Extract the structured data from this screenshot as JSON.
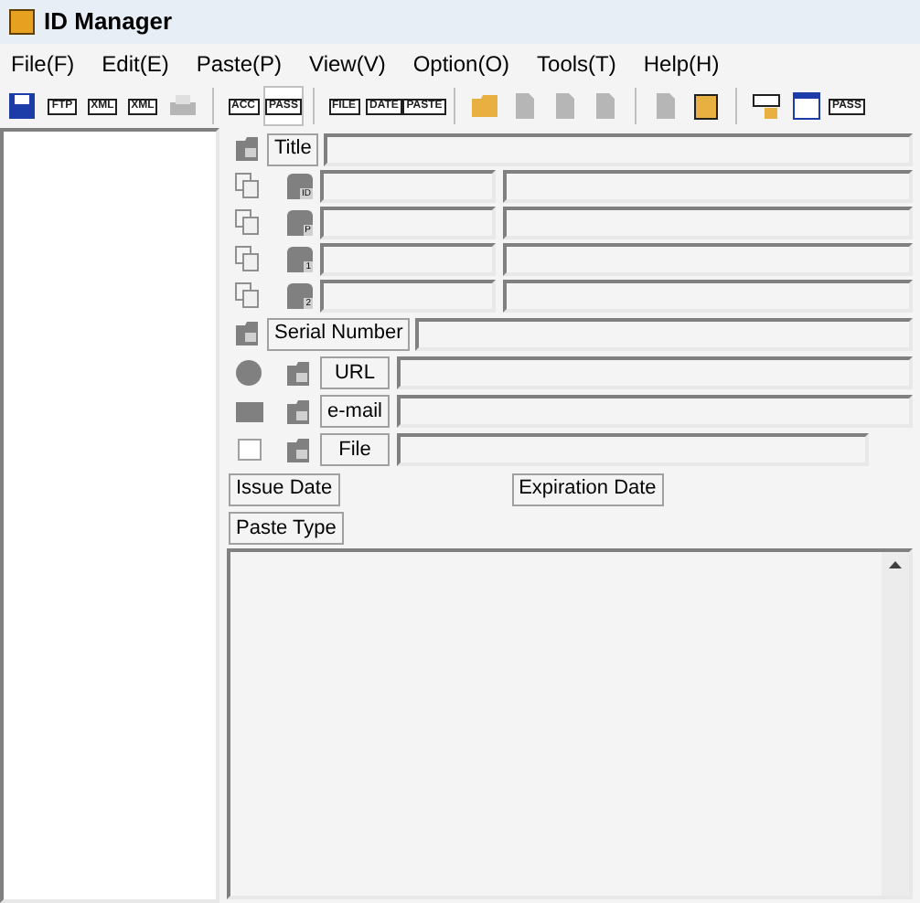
{
  "window": {
    "title": "ID Manager"
  },
  "menu": [
    "File(F)",
    "Edit(E)",
    "Paste(P)",
    "View(V)",
    "Option(O)",
    "Tools(T)",
    "Help(H)"
  ],
  "toolbar": [
    {
      "kind": "save",
      "disabled": false
    },
    {
      "kind": "glyph",
      "glyph": "FTP",
      "disabled": false
    },
    {
      "kind": "glyph",
      "glyph": "XML",
      "disabled": false
    },
    {
      "kind": "glyph",
      "glyph": "XML",
      "disabled": false
    },
    {
      "kind": "print",
      "disabled": true
    },
    {
      "kind": "separator"
    },
    {
      "kind": "glyph",
      "glyph": "ACC",
      "disabled": false,
      "selected": false
    },
    {
      "kind": "glyph",
      "glyph": "PASS",
      "disabled": false,
      "selected": true
    },
    {
      "kind": "separator"
    },
    {
      "kind": "glyph",
      "glyph": "FILE",
      "disabled": false
    },
    {
      "kind": "glyph",
      "glyph": "DATE",
      "disabled": false
    },
    {
      "kind": "glyph",
      "glyph": "PASTE",
      "disabled": false
    },
    {
      "kind": "separator"
    },
    {
      "kind": "folder",
      "disabled": false
    },
    {
      "kind": "document",
      "disabled": true
    },
    {
      "kind": "document",
      "disabled": true
    },
    {
      "kind": "document",
      "disabled": true
    },
    {
      "kind": "separator"
    },
    {
      "kind": "document",
      "disabled": true
    },
    {
      "kind": "clipboard",
      "disabled": false
    },
    {
      "kind": "separator"
    },
    {
      "kind": "lock",
      "disabled": false
    },
    {
      "kind": "window",
      "disabled": false
    },
    {
      "kind": "glyph",
      "glyph": "PASS",
      "disabled": false
    }
  ],
  "title_row": {
    "label": "Title"
  },
  "id_rows": [
    {
      "mark": "ID"
    },
    {
      "mark": "P"
    },
    {
      "mark": "1"
    },
    {
      "mark": "2"
    }
  ],
  "serial_row": {
    "label": "Serial Number"
  },
  "link_rows": [
    {
      "kind": "circle",
      "label": "URL"
    },
    {
      "kind": "rect",
      "label": "e-mail"
    },
    {
      "kind": "page",
      "label": "File"
    }
  ],
  "dates": {
    "issue": "Issue Date",
    "expiration": "Expiration Date"
  },
  "paste_type": "Paste Type"
}
